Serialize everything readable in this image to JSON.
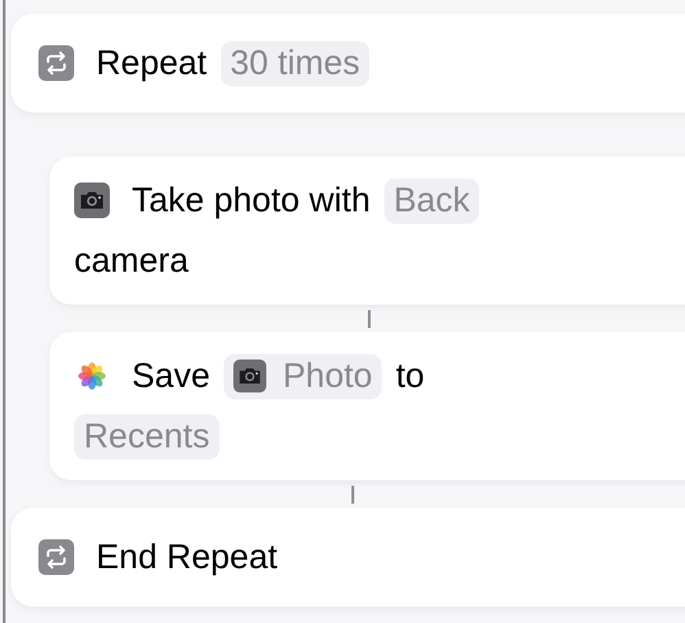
{
  "blocks": [
    {
      "kind": "repeat",
      "nested": false,
      "lines": [
        [
          {
            "kind": "word",
            "text": "Repeat"
          },
          {
            "kind": "param",
            "text": "30 times"
          }
        ]
      ]
    },
    {
      "kind": "camera",
      "nested": true,
      "lines": [
        [
          {
            "kind": "word",
            "text": "Take photo with"
          },
          {
            "kind": "param",
            "text": "Back"
          }
        ],
        [
          {
            "kind": "word",
            "text": "camera"
          }
        ]
      ]
    },
    {
      "kind": "photos",
      "nested": true,
      "lines": [
        [
          {
            "kind": "word",
            "text": "Save"
          },
          {
            "kind": "variable",
            "text": "Photo"
          },
          {
            "kind": "word",
            "text": "to"
          }
        ],
        [
          {
            "kind": "param",
            "text": "Recents"
          }
        ]
      ]
    },
    {
      "kind": "end",
      "nested": false,
      "lines": [
        [
          {
            "kind": "word",
            "text": "End Repeat"
          }
        ]
      ]
    }
  ]
}
